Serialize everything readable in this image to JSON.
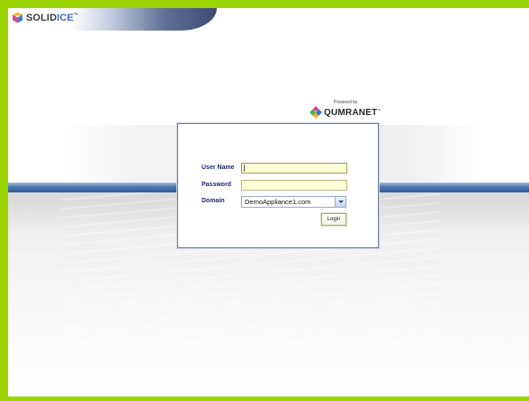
{
  "brand": {
    "name_part1": "SOLID",
    "name_part2": "ICE",
    "tm": "™"
  },
  "powered_by": {
    "label": "Powered by",
    "name": "QUMRANET",
    "tm": "™"
  },
  "login": {
    "username_label": "User Name",
    "username_value": "",
    "password_label": "Password",
    "password_value": "",
    "domain_label": "Domain",
    "domain_value": "DemoAppliance1.com",
    "login_button": "Login"
  },
  "colors": {
    "frame": "#9bd400",
    "band": "#2f5b98",
    "label": "#1e2a6b",
    "field_bg": "#ffffd6"
  }
}
